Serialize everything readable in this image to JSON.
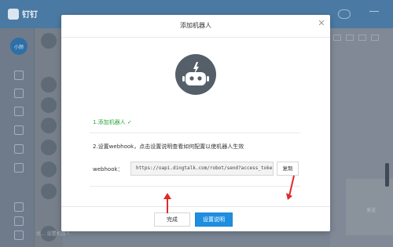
{
  "background_app": {
    "brand": "钉钉",
    "user_avatar_label": "小颜",
    "list_preview": "优... 设置机器人",
    "right_button": "发送"
  },
  "modal": {
    "title": "添加机器人",
    "close_icon": "close-icon",
    "robot_icon": "robot-icon",
    "step1_label": "1.添加机器人",
    "step1_check": "✓",
    "step2_label": "2.设置webhook，点击设置说明查看如何配置以使机器人生效",
    "webhook_label": "webhook：",
    "webhook_value": "https://oapi.dingtalk.com/robot/send?access_token=",
    "copy_button": "复制",
    "done_button": "完成",
    "settings_button": "设置说明"
  },
  "colors": {
    "success_green": "#2aa83b",
    "primary_blue": "#1e8fe0",
    "annotation_red": "#e02a2a",
    "robot_bg": "#555f69"
  }
}
